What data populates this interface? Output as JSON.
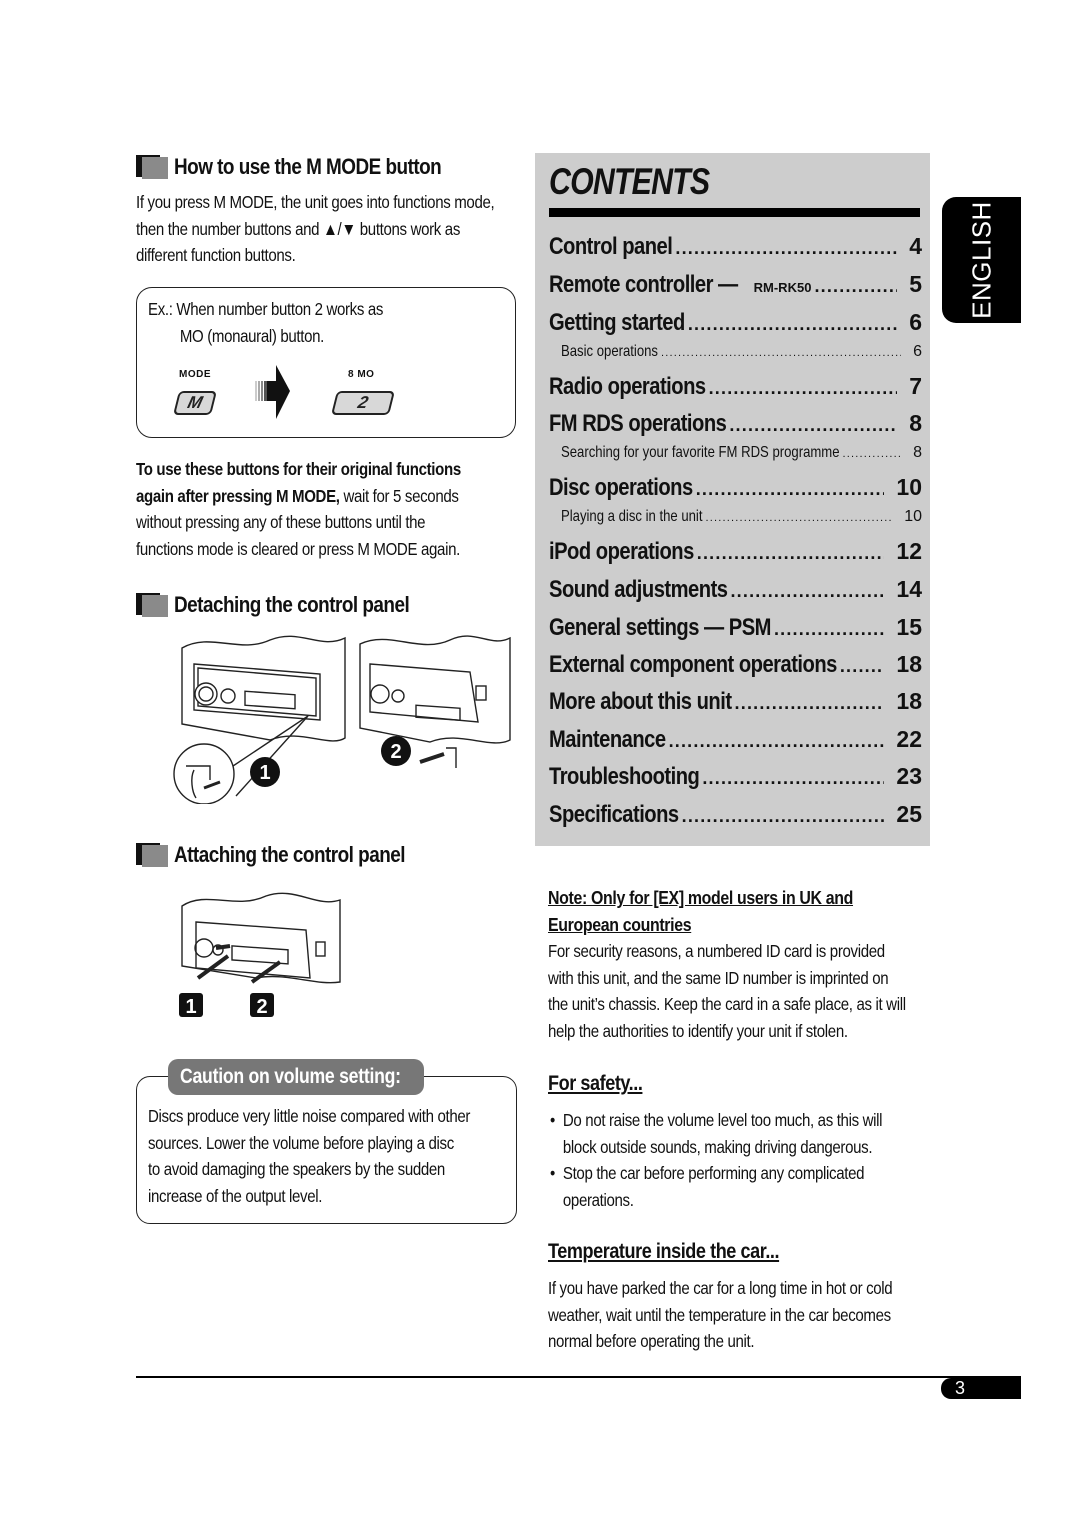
{
  "left_column": {
    "mmode_section": {
      "title": "How to use the M MODE button",
      "paragraph_lines": [
        "If you press M MODE, the unit goes into functions mode,",
        "then the number buttons and ▲/▼ buttons work as",
        "different function buttons."
      ],
      "example": {
        "line1": "Ex.:  When number button 2 works as",
        "line2": "MO (monaural) button.",
        "mode_key_label": "MODE",
        "mode_key_glyph": "M",
        "number_key_label": "8  MO",
        "number_key_glyph": "2"
      },
      "note_bold_line1": "To use these buttons for their original functions",
      "note_bold_line2": "again after pressing M MODE,",
      "note_rest_line2": " wait for 5 seconds",
      "note_line3": "without pressing any of these buttons until the",
      "note_line4": "functions mode is cleared or press M MODE again."
    },
    "detach_section": {
      "title": "Detaching the control panel",
      "step1": "1",
      "step2": "2"
    },
    "attach_section": {
      "title": "Attaching the control panel",
      "step1": "1",
      "step2": "2"
    },
    "caution": {
      "title": "Caution on volume setting:",
      "lines": [
        "Discs produce very little noise compared with other",
        "sources. Lower the volume before playing a disc",
        "to avoid damaging the speakers by the sudden",
        "increase of the output level."
      ]
    }
  },
  "contents": {
    "title": "CONTENTS",
    "entries": [
      {
        "label": "Control panel",
        "page": "4",
        "level": 1
      },
      {
        "label": "Remote controller — ",
        "suffix": "RM-RK50",
        "page": "5",
        "level": 1
      },
      {
        "label": "Getting started",
        "page": "6",
        "level": 1
      },
      {
        "label": "Basic operations",
        "page": "6",
        "level": 2
      },
      {
        "label": "Radio operations",
        "page": "7",
        "level": 1
      },
      {
        "label": "FM RDS operations",
        "page": "8",
        "level": 1
      },
      {
        "label": "Searching for your favorite FM RDS programme",
        "page": "8",
        "level": 2
      },
      {
        "label": "Disc operations",
        "page": "10",
        "level": 1
      },
      {
        "label": "Playing a disc in the unit",
        "page": "10",
        "level": 2
      },
      {
        "label": "iPod operations",
        "page": "12",
        "level": 1
      },
      {
        "label": "Sound adjustments",
        "page": "14",
        "level": 1
      },
      {
        "label": "General settings — PSM",
        "page": "15",
        "level": 1
      },
      {
        "label": "External component operations",
        "page": "18",
        "level": 1
      },
      {
        "label": "More about this unit",
        "page": "18",
        "level": 1
      },
      {
        "label": "Maintenance",
        "page": "22",
        "level": 1
      },
      {
        "label": "Troubleshooting",
        "page": "23",
        "level": 1
      },
      {
        "label": "Specifications",
        "page": "25",
        "level": 1
      }
    ]
  },
  "language_tab": "ENGLISH",
  "right_column": {
    "note": {
      "heading_line1": "Note: Only for [EX] model users in UK and",
      "heading_line2": "European countries",
      "lines": [
        "For security reasons, a numbered ID card is provided",
        "with this unit, and the same ID number is imprinted on",
        "the unit’s chassis. Keep the card in a safe place, as it will",
        "help the authorities to identify your unit if stolen."
      ]
    },
    "safety": {
      "heading": "For safety...",
      "bullets": [
        {
          "line1": "Do not raise the volume level too much, as this will",
          "line2": "block outside sounds, making driving dangerous."
        },
        {
          "line1": "Stop the car before performing any complicated",
          "line2": "operations."
        }
      ]
    },
    "temperature": {
      "heading": "Temperature inside the car...",
      "lines": [
        "If you have parked the car for a long time in hot or cold",
        "weather, wait until the temperature in the car becomes",
        "normal before operating the unit."
      ]
    }
  },
  "footer": {
    "page_number": "3"
  }
}
